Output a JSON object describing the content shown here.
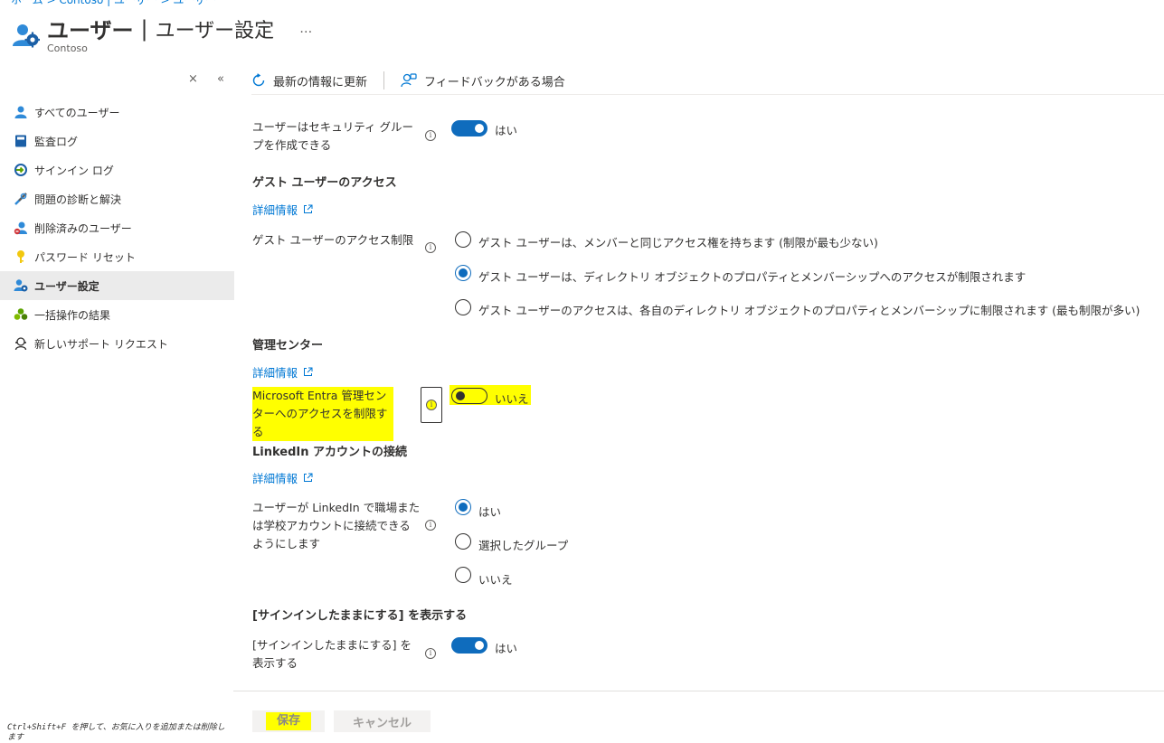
{
  "breadcrumb": "ホーム > Contoso | ユーザー > ユーザー",
  "header": {
    "title_main": "ユーザー",
    "title_sep": "|",
    "title_sub": "ユーザー設定",
    "more": "…",
    "tenant": "Contoso"
  },
  "sidebar": {
    "close_glyph": "×",
    "collapse_glyph": "«",
    "items": [
      {
        "label": "すべてのユーザー",
        "icon": "user-icon"
      },
      {
        "label": "監査ログ",
        "icon": "book-icon"
      },
      {
        "label": "サインイン ログ",
        "icon": "sign-in-icon"
      },
      {
        "label": "問題の診断と解決",
        "icon": "wrench-icon"
      },
      {
        "label": "削除済みのユーザー",
        "icon": "deleted-user-icon"
      },
      {
        "label": "パスワード リセット",
        "icon": "key-icon"
      },
      {
        "label": "ユーザー設定",
        "icon": "user-settings-icon",
        "active": true
      },
      {
        "label": "一括操作の結果",
        "icon": "bulk-results-icon"
      },
      {
        "label": "新しいサポート リクエスト",
        "icon": "support-icon"
      }
    ],
    "footer_hint": "Ctrl+Shift+F を押して、お気に入りを追加または削除します"
  },
  "toolbar": {
    "refresh": "最新の情報に更新",
    "feedback": "フィードバックがある場合"
  },
  "settings": {
    "security_groups": {
      "label": "ユーザーはセキュリティ グループを作成できる",
      "toggle": "はい"
    },
    "guest_access": {
      "section": "ゲスト ユーザーのアクセス",
      "link": "詳細情報",
      "label": "ゲスト ユーザーのアクセス制限",
      "options": [
        "ゲスト ユーザーは、メンバーと同じアクセス権を持ちます (制限が最も少ない)",
        "ゲスト ユーザーは、ディレクトリ オブジェクトのプロパティとメンバーシップへのアクセスが制限されます",
        "ゲスト ユーザーのアクセスは、各自のディレクトリ オブジェクトのプロパティとメンバーシップに制限されます (最も制限が多い)"
      ],
      "selected_index": 1
    },
    "admin_center": {
      "section": "管理センター",
      "link": "詳細情報",
      "label": "Microsoft Entra 管理センターへのアクセスを制限する",
      "toggle": "いいえ"
    },
    "linkedin": {
      "section": "LinkedIn アカウントの接続",
      "link": "詳細情報",
      "label": "ユーザーが LinkedIn で職場または学校アカウントに接続できるようにします",
      "options": [
        "はい",
        "選択したグループ",
        "いいえ"
      ],
      "selected_index": 0
    },
    "stay_signed_in": {
      "section": "[サインインしたままにする] を表示する",
      "label": "[サインインしたままにする] を表示する",
      "toggle": "はい"
    }
  },
  "actions": {
    "save": "保存",
    "cancel": "キャンセル"
  },
  "colors": {
    "accent": "#0f6cbd",
    "link": "#0078d4",
    "highlight": "#ffff00"
  }
}
